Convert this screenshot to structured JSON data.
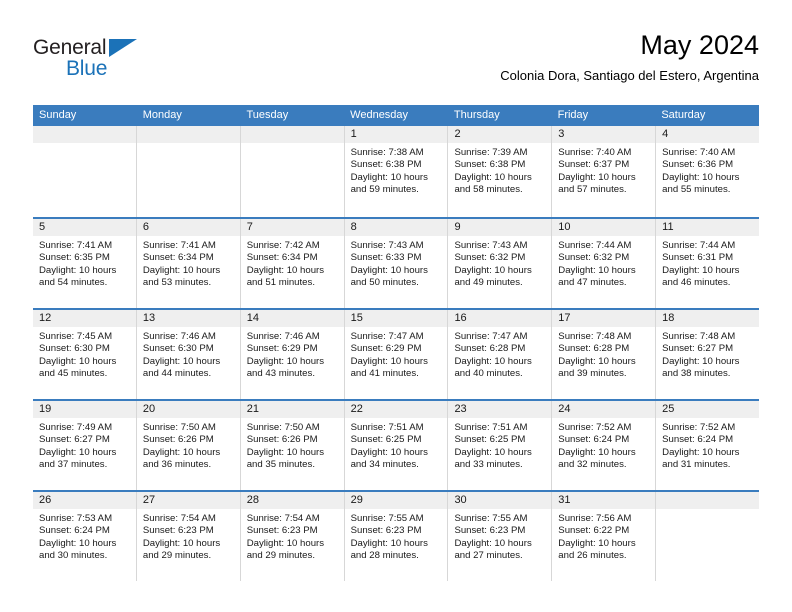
{
  "brand": {
    "name_part1": "General",
    "name_part2": "Blue",
    "accent_color": "#1b72b8"
  },
  "header": {
    "title": "May 2024",
    "subtitle": "Colonia Dora, Santiago del Estero, Argentina"
  },
  "theme": {
    "header_row_bg": "#3a7cbe",
    "daynum_bg": "#efefef",
    "grid_line": "#d7d7d7"
  },
  "calendar": {
    "weekday_headers": [
      "Sunday",
      "Monday",
      "Tuesday",
      "Wednesday",
      "Thursday",
      "Friday",
      "Saturday"
    ],
    "weeks": [
      [
        {
          "day": "",
          "sunrise": "",
          "sunset": "",
          "daylight_1": "",
          "daylight_2": ""
        },
        {
          "day": "",
          "sunrise": "",
          "sunset": "",
          "daylight_1": "",
          "daylight_2": ""
        },
        {
          "day": "",
          "sunrise": "",
          "sunset": "",
          "daylight_1": "",
          "daylight_2": ""
        },
        {
          "day": "1",
          "sunrise": "Sunrise: 7:38 AM",
          "sunset": "Sunset: 6:38 PM",
          "daylight_1": "Daylight: 10 hours",
          "daylight_2": "and 59 minutes."
        },
        {
          "day": "2",
          "sunrise": "Sunrise: 7:39 AM",
          "sunset": "Sunset: 6:38 PM",
          "daylight_1": "Daylight: 10 hours",
          "daylight_2": "and 58 minutes."
        },
        {
          "day": "3",
          "sunrise": "Sunrise: 7:40 AM",
          "sunset": "Sunset: 6:37 PM",
          "daylight_1": "Daylight: 10 hours",
          "daylight_2": "and 57 minutes."
        },
        {
          "day": "4",
          "sunrise": "Sunrise: 7:40 AM",
          "sunset": "Sunset: 6:36 PM",
          "daylight_1": "Daylight: 10 hours",
          "daylight_2": "and 55 minutes."
        }
      ],
      [
        {
          "day": "5",
          "sunrise": "Sunrise: 7:41 AM",
          "sunset": "Sunset: 6:35 PM",
          "daylight_1": "Daylight: 10 hours",
          "daylight_2": "and 54 minutes."
        },
        {
          "day": "6",
          "sunrise": "Sunrise: 7:41 AM",
          "sunset": "Sunset: 6:34 PM",
          "daylight_1": "Daylight: 10 hours",
          "daylight_2": "and 53 minutes."
        },
        {
          "day": "7",
          "sunrise": "Sunrise: 7:42 AM",
          "sunset": "Sunset: 6:34 PM",
          "daylight_1": "Daylight: 10 hours",
          "daylight_2": "and 51 minutes."
        },
        {
          "day": "8",
          "sunrise": "Sunrise: 7:43 AM",
          "sunset": "Sunset: 6:33 PM",
          "daylight_1": "Daylight: 10 hours",
          "daylight_2": "and 50 minutes."
        },
        {
          "day": "9",
          "sunrise": "Sunrise: 7:43 AM",
          "sunset": "Sunset: 6:32 PM",
          "daylight_1": "Daylight: 10 hours",
          "daylight_2": "and 49 minutes."
        },
        {
          "day": "10",
          "sunrise": "Sunrise: 7:44 AM",
          "sunset": "Sunset: 6:32 PM",
          "daylight_1": "Daylight: 10 hours",
          "daylight_2": "and 47 minutes."
        },
        {
          "day": "11",
          "sunrise": "Sunrise: 7:44 AM",
          "sunset": "Sunset: 6:31 PM",
          "daylight_1": "Daylight: 10 hours",
          "daylight_2": "and 46 minutes."
        }
      ],
      [
        {
          "day": "12",
          "sunrise": "Sunrise: 7:45 AM",
          "sunset": "Sunset: 6:30 PM",
          "daylight_1": "Daylight: 10 hours",
          "daylight_2": "and 45 minutes."
        },
        {
          "day": "13",
          "sunrise": "Sunrise: 7:46 AM",
          "sunset": "Sunset: 6:30 PM",
          "daylight_1": "Daylight: 10 hours",
          "daylight_2": "and 44 minutes."
        },
        {
          "day": "14",
          "sunrise": "Sunrise: 7:46 AM",
          "sunset": "Sunset: 6:29 PM",
          "daylight_1": "Daylight: 10 hours",
          "daylight_2": "and 43 minutes."
        },
        {
          "day": "15",
          "sunrise": "Sunrise: 7:47 AM",
          "sunset": "Sunset: 6:29 PM",
          "daylight_1": "Daylight: 10 hours",
          "daylight_2": "and 41 minutes."
        },
        {
          "day": "16",
          "sunrise": "Sunrise: 7:47 AM",
          "sunset": "Sunset: 6:28 PM",
          "daylight_1": "Daylight: 10 hours",
          "daylight_2": "and 40 minutes."
        },
        {
          "day": "17",
          "sunrise": "Sunrise: 7:48 AM",
          "sunset": "Sunset: 6:28 PM",
          "daylight_1": "Daylight: 10 hours",
          "daylight_2": "and 39 minutes."
        },
        {
          "day": "18",
          "sunrise": "Sunrise: 7:48 AM",
          "sunset": "Sunset: 6:27 PM",
          "daylight_1": "Daylight: 10 hours",
          "daylight_2": "and 38 minutes."
        }
      ],
      [
        {
          "day": "19",
          "sunrise": "Sunrise: 7:49 AM",
          "sunset": "Sunset: 6:27 PM",
          "daylight_1": "Daylight: 10 hours",
          "daylight_2": "and 37 minutes."
        },
        {
          "day": "20",
          "sunrise": "Sunrise: 7:50 AM",
          "sunset": "Sunset: 6:26 PM",
          "daylight_1": "Daylight: 10 hours",
          "daylight_2": "and 36 minutes."
        },
        {
          "day": "21",
          "sunrise": "Sunrise: 7:50 AM",
          "sunset": "Sunset: 6:26 PM",
          "daylight_1": "Daylight: 10 hours",
          "daylight_2": "and 35 minutes."
        },
        {
          "day": "22",
          "sunrise": "Sunrise: 7:51 AM",
          "sunset": "Sunset: 6:25 PM",
          "daylight_1": "Daylight: 10 hours",
          "daylight_2": "and 34 minutes."
        },
        {
          "day": "23",
          "sunrise": "Sunrise: 7:51 AM",
          "sunset": "Sunset: 6:25 PM",
          "daylight_1": "Daylight: 10 hours",
          "daylight_2": "and 33 minutes."
        },
        {
          "day": "24",
          "sunrise": "Sunrise: 7:52 AM",
          "sunset": "Sunset: 6:24 PM",
          "daylight_1": "Daylight: 10 hours",
          "daylight_2": "and 32 minutes."
        },
        {
          "day": "25",
          "sunrise": "Sunrise: 7:52 AM",
          "sunset": "Sunset: 6:24 PM",
          "daylight_1": "Daylight: 10 hours",
          "daylight_2": "and 31 minutes."
        }
      ],
      [
        {
          "day": "26",
          "sunrise": "Sunrise: 7:53 AM",
          "sunset": "Sunset: 6:24 PM",
          "daylight_1": "Daylight: 10 hours",
          "daylight_2": "and 30 minutes."
        },
        {
          "day": "27",
          "sunrise": "Sunrise: 7:54 AM",
          "sunset": "Sunset: 6:23 PM",
          "daylight_1": "Daylight: 10 hours",
          "daylight_2": "and 29 minutes."
        },
        {
          "day": "28",
          "sunrise": "Sunrise: 7:54 AM",
          "sunset": "Sunset: 6:23 PM",
          "daylight_1": "Daylight: 10 hours",
          "daylight_2": "and 29 minutes."
        },
        {
          "day": "29",
          "sunrise": "Sunrise: 7:55 AM",
          "sunset": "Sunset: 6:23 PM",
          "daylight_1": "Daylight: 10 hours",
          "daylight_2": "and 28 minutes."
        },
        {
          "day": "30",
          "sunrise": "Sunrise: 7:55 AM",
          "sunset": "Sunset: 6:23 PM",
          "daylight_1": "Daylight: 10 hours",
          "daylight_2": "and 27 minutes."
        },
        {
          "day": "31",
          "sunrise": "Sunrise: 7:56 AM",
          "sunset": "Sunset: 6:22 PM",
          "daylight_1": "Daylight: 10 hours",
          "daylight_2": "and 26 minutes."
        },
        {
          "day": "",
          "sunrise": "",
          "sunset": "",
          "daylight_1": "",
          "daylight_2": ""
        }
      ]
    ]
  }
}
